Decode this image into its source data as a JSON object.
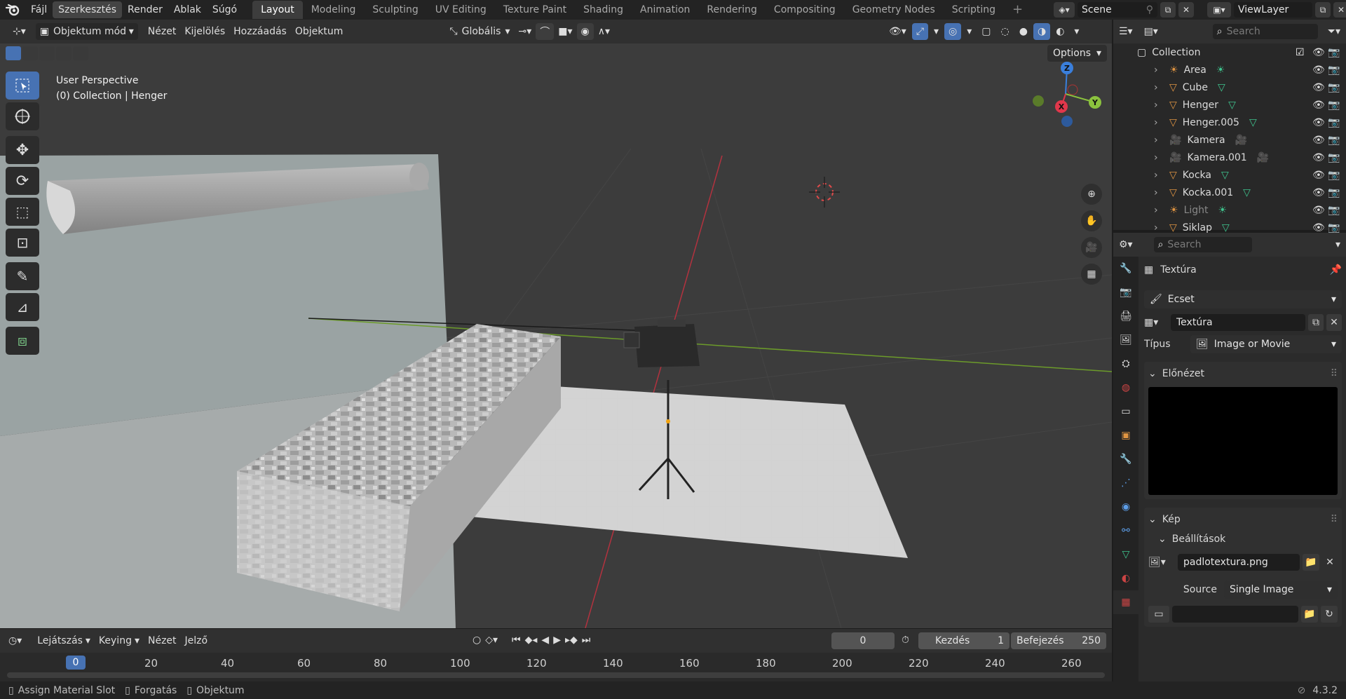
{
  "menu": [
    "Fájl",
    "Szerkesztés",
    "Render",
    "Ablak",
    "Súgó"
  ],
  "workspaces": [
    "Layout",
    "Modeling",
    "Sculpting",
    "UV Editing",
    "Texture Paint",
    "Shading",
    "Animation",
    "Rendering",
    "Compositing",
    "Geometry Nodes",
    "Scripting"
  ],
  "scene": {
    "name": "Scene",
    "view_layer": "ViewLayer"
  },
  "viewport_header": {
    "mode": "Objektum mód",
    "items": [
      "Nézet",
      "Kijelölés",
      "Hozzáadás",
      "Objektum"
    ],
    "transform": "Globális",
    "options": "Options"
  },
  "viewport": {
    "perspective": "User Perspective",
    "context": "(0) Collection | Henger",
    "axes": {
      "x": "X",
      "y": "Y",
      "z": "Z"
    }
  },
  "outliner": {
    "search_placeholder": "Search",
    "collection": "Collection",
    "items": [
      {
        "name": "Area",
        "type": "light"
      },
      {
        "name": "Cube",
        "type": "mesh"
      },
      {
        "name": "Henger",
        "type": "mesh"
      },
      {
        "name": "Henger.005",
        "type": "mesh"
      },
      {
        "name": "Kamera",
        "type": "camera"
      },
      {
        "name": "Kamera.001",
        "type": "camera"
      },
      {
        "name": "Kocka",
        "type": "mesh"
      },
      {
        "name": "Kocka.001",
        "type": "mesh"
      },
      {
        "name": "Light",
        "type": "light"
      },
      {
        "name": "Siklap",
        "type": "mesh"
      }
    ]
  },
  "properties": {
    "search_placeholder": "Search",
    "header": "Textúra",
    "brush": "Ecset",
    "texture": "Textúra",
    "type_label": "Típus",
    "type_value": "Image or Movie",
    "preview_label": "Előnézet",
    "image_label": "Kép",
    "settings_label": "Beállítások",
    "image_file": "padlotextura.png",
    "source_label": "Source",
    "source_value": "Single Image"
  },
  "timeline": {
    "menus": [
      "Lejátszás",
      "Keying",
      "Nézet",
      "Jelző"
    ],
    "current_frame": "0",
    "start_label": "Kezdés",
    "start": "1",
    "end_label": "Befejezés",
    "end": "250",
    "ticks": [
      "20",
      "40",
      "60",
      "80",
      "100",
      "120",
      "140",
      "160",
      "180",
      "200",
      "220",
      "240",
      "260"
    ],
    "playhead": "0"
  },
  "statusbar": {
    "items": [
      "Assign Material Slot",
      "Forgatás",
      "Objektum"
    ],
    "version": "4.3.2"
  },
  "colors": {
    "accent": "#4772b3",
    "x_axis": "#e0374b",
    "y_axis": "#8bc23e",
    "z_axis": "#3a7fdc",
    "mesh": "#e09542",
    "data": "#3fc48e"
  }
}
